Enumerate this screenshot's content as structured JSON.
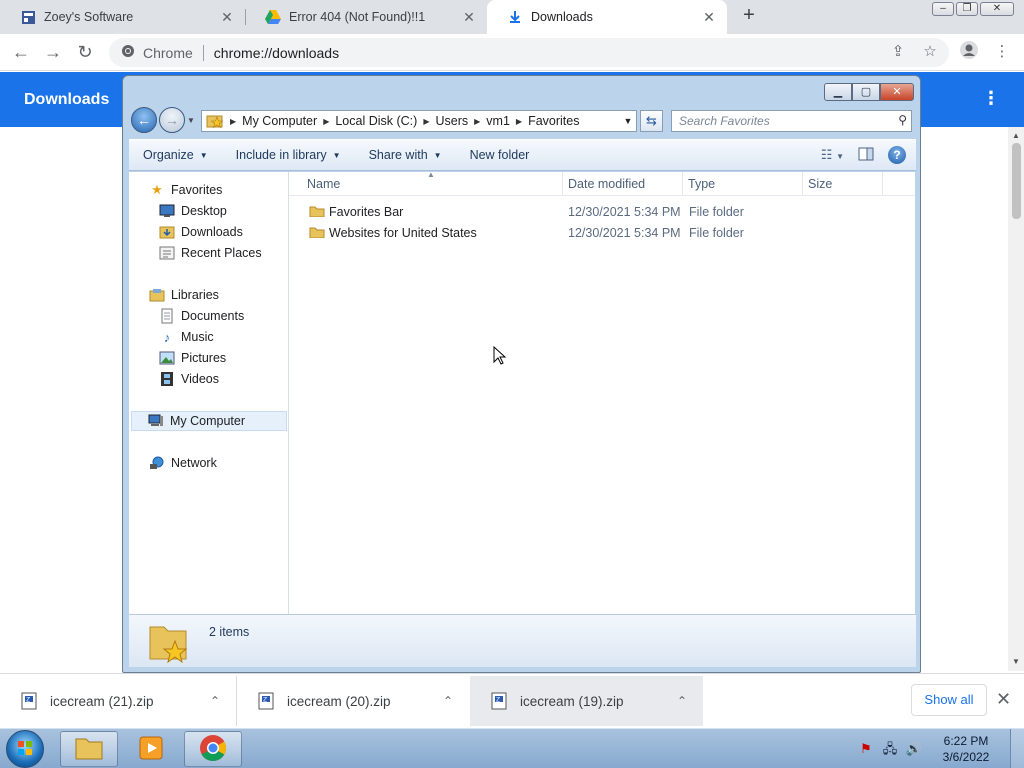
{
  "chrome": {
    "tabs": [
      {
        "title": "Zoey's Software",
        "icon": "site-icon"
      },
      {
        "title": "Error 404 (Not Found)!!1",
        "icon": "google-drive-icon"
      },
      {
        "title": "Downloads",
        "icon": "download-icon",
        "active": true
      }
    ],
    "omnibox": {
      "site": "Chrome",
      "url": "chrome://downloads"
    },
    "page_title": "Downloads",
    "accent": "#1a73e8"
  },
  "explorer": {
    "breadcrumb": [
      "My Computer",
      "Local Disk (C:)",
      "Users",
      "vm1",
      "Favorites"
    ],
    "search_placeholder": "Search Favorites",
    "commands": {
      "organize": "Organize",
      "include": "Include in library",
      "share": "Share with",
      "new_folder": "New folder"
    },
    "nav": {
      "favorites": "Favorites",
      "desktop": "Desktop",
      "downloads": "Downloads",
      "recent": "Recent Places",
      "libraries": "Libraries",
      "documents": "Documents",
      "music": "Music",
      "pictures": "Pictures",
      "videos": "Videos",
      "computer": "My Computer",
      "network": "Network"
    },
    "columns": {
      "name": "Name",
      "date": "Date modified",
      "type": "Type",
      "size": "Size"
    },
    "files": [
      {
        "name": "Favorites Bar",
        "date": "12/30/2021 5:34 PM",
        "type": "File folder"
      },
      {
        "name": "Websites for United States",
        "date": "12/30/2021 5:34 PM",
        "type": "File folder"
      }
    ],
    "status": "2 items"
  },
  "shelf": {
    "items": [
      "icecream (21).zip",
      "icecream (20).zip",
      "icecream (19).zip"
    ],
    "show_all": "Show all"
  },
  "taskbar": {
    "time": "6:22 PM",
    "date": "3/6/2022"
  }
}
